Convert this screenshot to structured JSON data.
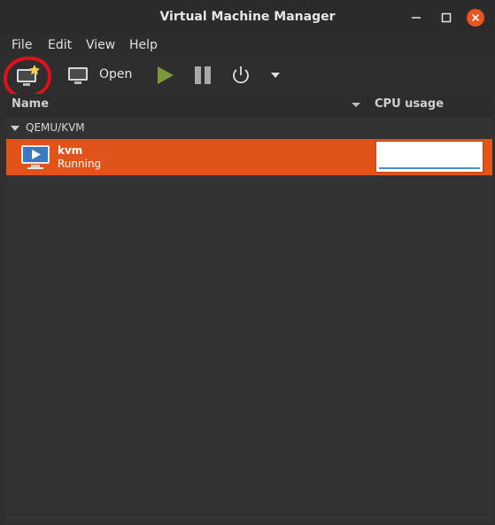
{
  "window": {
    "title": "Virtual Machine Manager"
  },
  "menubar": {
    "items": [
      "File",
      "Edit",
      "View",
      "Help"
    ]
  },
  "toolbar": {
    "new_vm_icon": "new-vm-icon",
    "open_label": "Open",
    "colors": {
      "run": "#7a9a3a",
      "annotation_circle": "#e0101a"
    }
  },
  "list": {
    "columns": {
      "name": "Name",
      "cpu": "CPU usage"
    },
    "group": "QEMU/KVM",
    "vms": [
      {
        "name": "kvm",
        "status": "Running"
      }
    ]
  },
  "colors": {
    "selection": "#e05419",
    "close_button": "#e95420",
    "cpu_line": "#4a90c8"
  }
}
